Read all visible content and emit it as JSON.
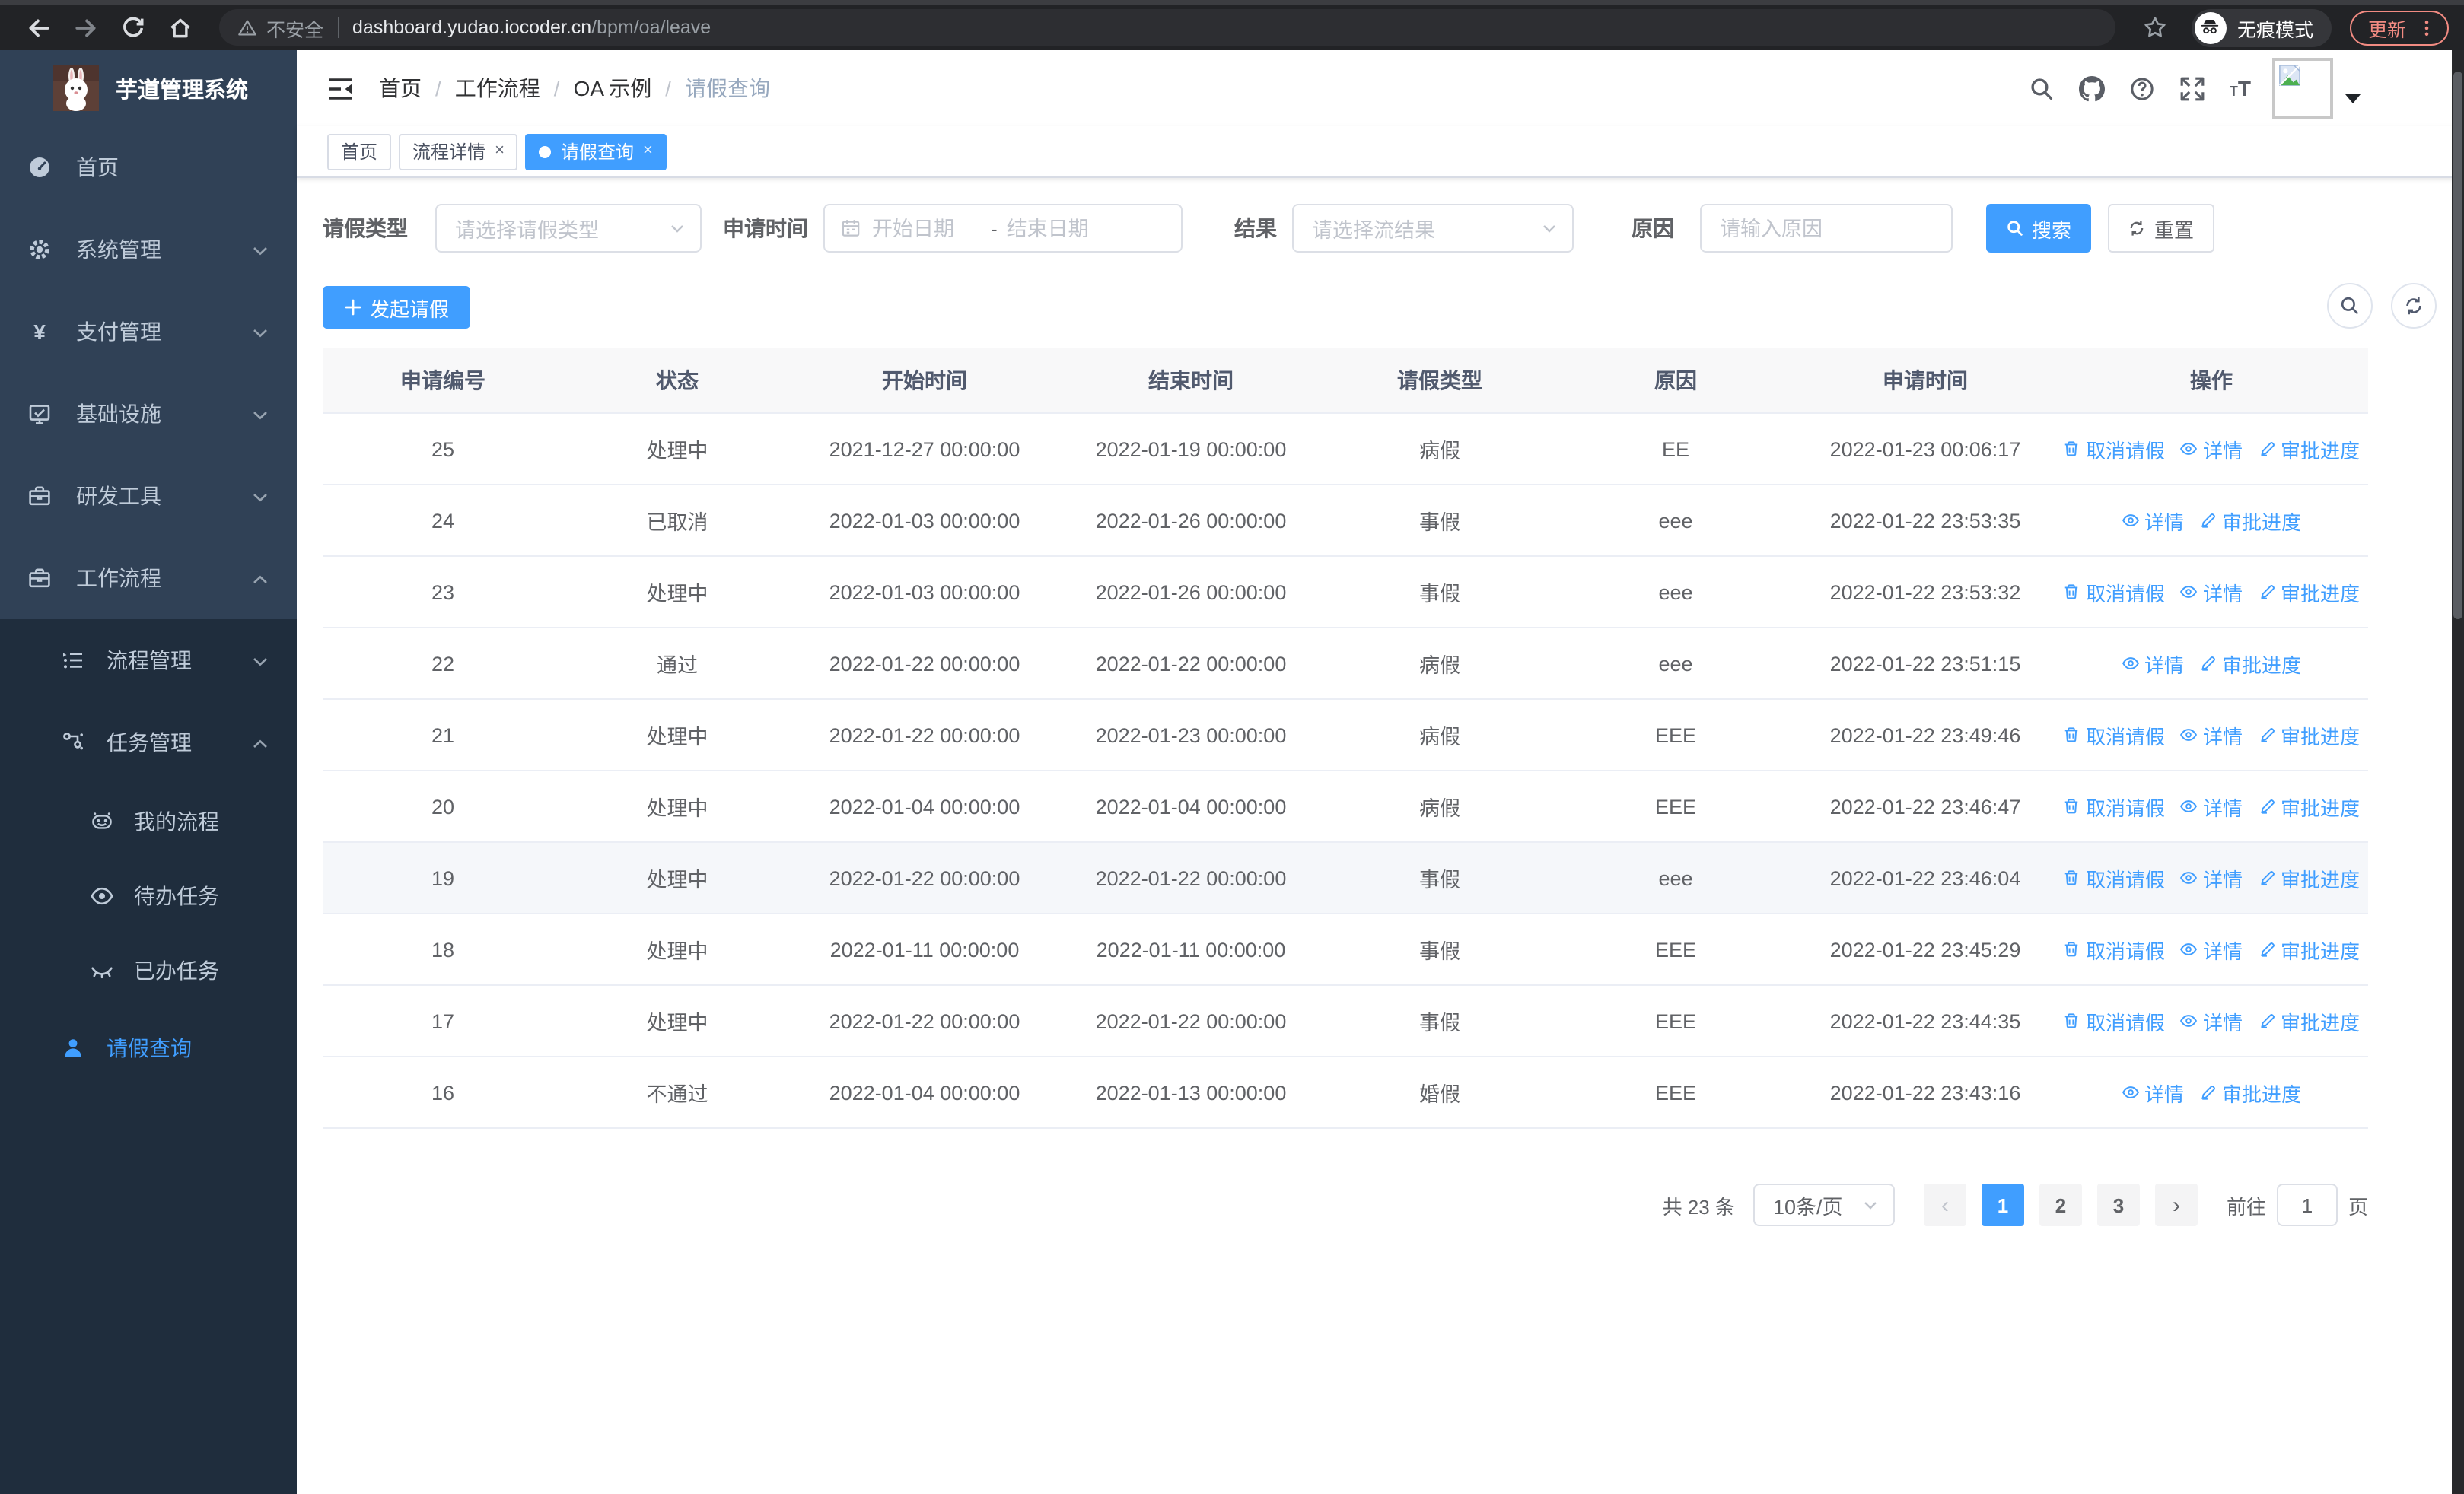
{
  "browser": {
    "security_label": "不安全",
    "url_host": "dashboard.yudao.iocoder.cn",
    "url_path": "/bpm/oa/leave",
    "incognito_label": "无痕模式",
    "update_label": "更新"
  },
  "sidebar": {
    "title": "芋道管理系统",
    "menu": [
      {
        "label": "首页",
        "icon": "dashboard-icon"
      },
      {
        "label": "系统管理",
        "icon": "gear-icon",
        "chevron": "down"
      },
      {
        "label": "支付管理",
        "icon": "yen-icon",
        "chevron": "down"
      },
      {
        "label": "基础设施",
        "icon": "monitor-icon",
        "chevron": "down"
      },
      {
        "label": "研发工具",
        "icon": "toolbox-icon",
        "chevron": "down"
      },
      {
        "label": "工作流程",
        "icon": "briefcase-icon",
        "chevron": "up"
      }
    ],
    "submenu": [
      {
        "label": "流程管理",
        "icon": "list-icon",
        "chevron": "down",
        "indent": 1
      },
      {
        "label": "任务管理",
        "icon": "flow-icon",
        "chevron": "up",
        "indent": 1
      },
      {
        "label": "我的流程",
        "icon": "robot-icon",
        "indent": 2
      },
      {
        "label": "待办任务",
        "icon": "eye-icon",
        "indent": 2
      },
      {
        "label": "已办任务",
        "icon": "eye-closed-icon",
        "indent": 2
      },
      {
        "label": "请假查询",
        "icon": "user-icon",
        "indent": 1,
        "active": true
      }
    ]
  },
  "header": {
    "breadcrumb": [
      "首页",
      "工作流程",
      "OA 示例",
      "请假查询"
    ],
    "breadcrumb_separator": "/"
  },
  "tabs": {
    "close_glyph": "×",
    "items": [
      {
        "label": "首页",
        "closable": false,
        "active": false
      },
      {
        "label": "流程详情",
        "closable": true,
        "active": false
      },
      {
        "label": "请假查询",
        "closable": true,
        "active": true
      }
    ]
  },
  "filters": {
    "leave_type_label": "请假类型",
    "leave_type_placeholder": "请选择请假类型",
    "apply_time_label": "申请时间",
    "date_start_placeholder": "开始日期",
    "date_separator": "-",
    "date_end_placeholder": "结束日期",
    "result_label": "结果",
    "result_placeholder": "请选择流结果",
    "reason_label": "原因",
    "reason_placeholder": "请输入原因",
    "search_label": "搜索",
    "reset_label": "重置"
  },
  "toolbar": {
    "create_label": "发起请假"
  },
  "table": {
    "columns": [
      "申请编号",
      "状态",
      "开始时间",
      "结束时间",
      "请假类型",
      "原因",
      "申请时间",
      "操作"
    ],
    "action_labels": {
      "cancel": "取消请假",
      "detail": "详情",
      "progress": "审批进度"
    },
    "rows": [
      {
        "id": "25",
        "status": "处理中",
        "start": "2021-12-27 00:00:00",
        "end": "2022-01-19 00:00:00",
        "type": "病假",
        "reason": "EE",
        "apply_time": "2022-01-23 00:06:17",
        "actions": [
          "cancel",
          "detail",
          "progress"
        ],
        "highlight": false
      },
      {
        "id": "24",
        "status": "已取消",
        "start": "2022-01-03 00:00:00",
        "end": "2022-01-26 00:00:00",
        "type": "事假",
        "reason": "eee",
        "apply_time": "2022-01-22 23:53:35",
        "actions": [
          "detail",
          "progress"
        ],
        "highlight": false
      },
      {
        "id": "23",
        "status": "处理中",
        "start": "2022-01-03 00:00:00",
        "end": "2022-01-26 00:00:00",
        "type": "事假",
        "reason": "eee",
        "apply_time": "2022-01-22 23:53:32",
        "actions": [
          "cancel",
          "detail",
          "progress"
        ],
        "highlight": false
      },
      {
        "id": "22",
        "status": "通过",
        "start": "2022-01-22 00:00:00",
        "end": "2022-01-22 00:00:00",
        "type": "病假",
        "reason": "eee",
        "apply_time": "2022-01-22 23:51:15",
        "actions": [
          "detail",
          "progress"
        ],
        "highlight": false
      },
      {
        "id": "21",
        "status": "处理中",
        "start": "2022-01-22 00:00:00",
        "end": "2022-01-23 00:00:00",
        "type": "病假",
        "reason": "EEE",
        "apply_time": "2022-01-22 23:49:46",
        "actions": [
          "cancel",
          "detail",
          "progress"
        ],
        "highlight": false
      },
      {
        "id": "20",
        "status": "处理中",
        "start": "2022-01-04 00:00:00",
        "end": "2022-01-04 00:00:00",
        "type": "病假",
        "reason": "EEE",
        "apply_time": "2022-01-22 23:46:47",
        "actions": [
          "cancel",
          "detail",
          "progress"
        ],
        "highlight": false
      },
      {
        "id": "19",
        "status": "处理中",
        "start": "2022-01-22 00:00:00",
        "end": "2022-01-22 00:00:00",
        "type": "事假",
        "reason": "eee",
        "apply_time": "2022-01-22 23:46:04",
        "actions": [
          "cancel",
          "detail",
          "progress"
        ],
        "highlight": true
      },
      {
        "id": "18",
        "status": "处理中",
        "start": "2022-01-11 00:00:00",
        "end": "2022-01-11 00:00:00",
        "type": "事假",
        "reason": "EEE",
        "apply_time": "2022-01-22 23:45:29",
        "actions": [
          "cancel",
          "detail",
          "progress"
        ],
        "highlight": false
      },
      {
        "id": "17",
        "status": "处理中",
        "start": "2022-01-22 00:00:00",
        "end": "2022-01-22 00:00:00",
        "type": "事假",
        "reason": "EEE",
        "apply_time": "2022-01-22 23:44:35",
        "actions": [
          "cancel",
          "detail",
          "progress"
        ],
        "highlight": false
      },
      {
        "id": "16",
        "status": "不通过",
        "start": "2022-01-04 00:00:00",
        "end": "2022-01-13 00:00:00",
        "type": "婚假",
        "reason": "EEE",
        "apply_time": "2022-01-22 23:43:16",
        "actions": [
          "detail",
          "progress"
        ],
        "highlight": false
      }
    ]
  },
  "pagination": {
    "total_label": "共 23 条",
    "page_size": "10条/页",
    "prev_glyph": "‹",
    "next_glyph": "›",
    "pages": [
      "1",
      "2",
      "3"
    ],
    "active_page": "1",
    "goto_label": "前往",
    "goto_value": "1",
    "page_unit": "页"
  },
  "colors": {
    "primary": "#409EFF",
    "sidebar_bg": "#304156",
    "submenu_bg": "#1F2D3D",
    "sidebar_text": "#BFCBD9",
    "table_header_bg": "#F8F8F9",
    "row_border": "#EBEEF5",
    "browser_bar": "#222326",
    "update_accent": "#F28B82"
  }
}
